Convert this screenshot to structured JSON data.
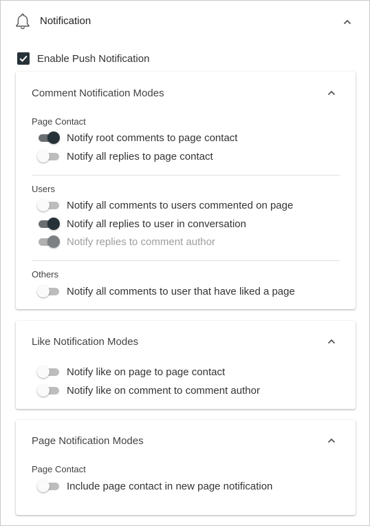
{
  "header": {
    "title": "Notification",
    "icon": "bell-icon"
  },
  "enable_push": {
    "label": "Enable Push Notification",
    "checked": true
  },
  "comment_modes": {
    "title": "Comment Notification Modes",
    "page_contact": {
      "label": "Page Contact",
      "toggles": [
        {
          "label": "Notify root comments to page contact",
          "on": true
        },
        {
          "label": "Notify all replies to page contact",
          "on": false
        }
      ]
    },
    "users": {
      "label": "Users",
      "toggles": [
        {
          "label": "Notify all comments to users commented on page",
          "on": false
        },
        {
          "label": "Notify all replies to user in conversation",
          "on": true
        },
        {
          "label": "Notify replies to comment author",
          "on": true,
          "disabled": true
        }
      ]
    },
    "others": {
      "label": "Others",
      "toggles": [
        {
          "label": "Notify all comments to user that have liked a page",
          "on": false
        }
      ]
    }
  },
  "like_modes": {
    "title": "Like Notification Modes",
    "toggles": [
      {
        "label": "Notify like on page to page contact",
        "on": false
      },
      {
        "label": "Notify like on comment to comment author",
        "on": false
      }
    ]
  },
  "page_modes": {
    "title": "Page Notification Modes",
    "page_contact": {
      "label": "Page Contact",
      "toggles": [
        {
          "label": "Include page contact in new page notification",
          "on": false
        }
      ]
    }
  },
  "colors": {
    "accent": "#263238",
    "track_on": "#6b6f72",
    "track_off": "#bdbdbd",
    "muted_text": "#9e9e9e"
  }
}
